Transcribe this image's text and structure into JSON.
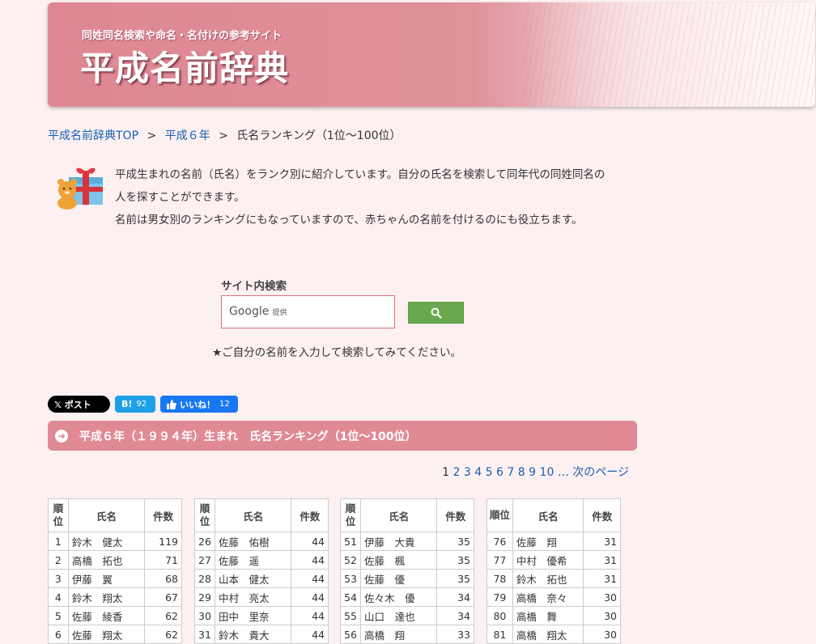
{
  "header": {
    "subtitle": "同姓同名検索や命名・名付けの参考サイト",
    "title": "平成名前辞典"
  },
  "breadcrumb": {
    "home": "平成名前辞典TOP",
    "year": "平成６年",
    "current": "氏名ランキング（1位〜100位）",
    "separator": ">"
  },
  "intro": {
    "line1": "平成生まれの名前（氏名）をランク別に紹介しています。自分の氏名を検索して同年代の同姓同名の",
    "line2": "人を探すことができます。",
    "line3": "名前は男女別のランキングにもなっていますので、赤ちゃんの名前を付けるのにも役立ちます。"
  },
  "search": {
    "label": "サイト内検索",
    "brand": "Google",
    "brand_sub": "提供",
    "hint": "★ご自分の名前を入力して検索してみてください。"
  },
  "social": {
    "x_label": "𝕏 ポスト",
    "hatena_label": "B!",
    "hatena_count": "92",
    "fb_label": "いいね！",
    "fb_count": "12"
  },
  "section_title": "平成６年（１９９４年）生まれ　氏名ランキング（1位〜100位）",
  "pager": {
    "pages": [
      "1",
      "2",
      "3",
      "4",
      "5",
      "6",
      "7",
      "8",
      "9",
      "10"
    ],
    "ellipsis": "…",
    "next": "次のページ"
  },
  "table_headers": {
    "rank": "順位",
    "name": "氏名",
    "count": "件数"
  },
  "tables": [
    {
      "rows": [
        {
          "rank": "1",
          "name": "鈴木　健太",
          "count": "119"
        },
        {
          "rank": "2",
          "name": "高橋　拓也",
          "count": "71"
        },
        {
          "rank": "3",
          "name": "伊藤　翼",
          "count": "68"
        },
        {
          "rank": "4",
          "name": "鈴木　翔太",
          "count": "67"
        },
        {
          "rank": "5",
          "name": "佐藤　綾香",
          "count": "62"
        },
        {
          "rank": "6",
          "name": "佐藤　翔太",
          "count": "62"
        }
      ]
    },
    {
      "rows": [
        {
          "rank": "26",
          "name": "佐藤　佑樹",
          "count": "44"
        },
        {
          "rank": "27",
          "name": "佐藤　遥",
          "count": "44"
        },
        {
          "rank": "28",
          "name": "山本　健太",
          "count": "44"
        },
        {
          "rank": "29",
          "name": "中村　亮太",
          "count": "44"
        },
        {
          "rank": "30",
          "name": "田中　里奈",
          "count": "44"
        },
        {
          "rank": "31",
          "name": "鈴木　貴大",
          "count": "44"
        }
      ]
    },
    {
      "rows": [
        {
          "rank": "51",
          "name": "伊藤　大貴",
          "count": "35"
        },
        {
          "rank": "52",
          "name": "佐藤　楓",
          "count": "35"
        },
        {
          "rank": "53",
          "name": "佐藤　優",
          "count": "35"
        },
        {
          "rank": "54",
          "name": "佐々木　優",
          "count": "34"
        },
        {
          "rank": "55",
          "name": "山口　達也",
          "count": "34"
        },
        {
          "rank": "56",
          "name": "高橋　翔",
          "count": "33"
        }
      ]
    },
    {
      "rows": [
        {
          "rank": "76",
          "name": "佐藤　翔",
          "count": "31"
        },
        {
          "rank": "77",
          "name": "中村　優希",
          "count": "31"
        },
        {
          "rank": "78",
          "name": "鈴木　拓也",
          "count": "31"
        },
        {
          "rank": "79",
          "name": "高橋　奈々",
          "count": "30"
        },
        {
          "rank": "80",
          "name": "高橋　舞",
          "count": "30"
        },
        {
          "rank": "81",
          "name": "高橋　翔太",
          "count": "30"
        }
      ]
    }
  ]
}
